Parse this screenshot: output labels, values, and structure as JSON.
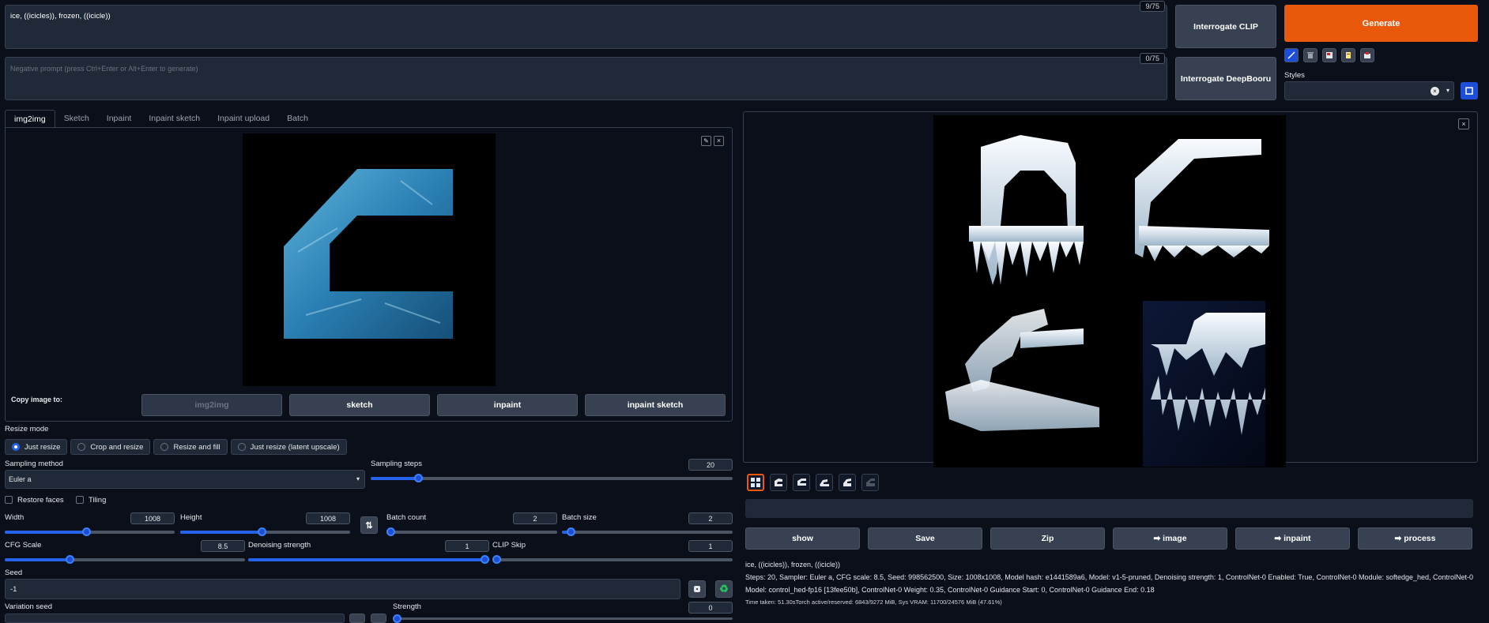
{
  "prompt": {
    "value": "ice, ((icicles)), frozen, ((icicle))",
    "token_count": "9/75"
  },
  "negative_prompt": {
    "placeholder": "Negative prompt (press Ctrl+Enter or Alt+Enter to generate)",
    "token_count": "0/75"
  },
  "interrogate": {
    "clip": "Interrogate CLIP",
    "deepbooru": "Interrogate DeepBooru"
  },
  "generate_label": "Generate",
  "styles_label": "Styles",
  "tabs": [
    "img2img",
    "Sketch",
    "Inpaint",
    "Inpaint sketch",
    "Inpaint upload",
    "Batch"
  ],
  "copy_image": {
    "label": "Copy image to:",
    "buttons": [
      "img2img",
      "sketch",
      "inpaint",
      "inpaint sketch"
    ]
  },
  "resize_mode": {
    "label": "Resize mode",
    "options": [
      "Just resize",
      "Crop and resize",
      "Resize and fill",
      "Just resize (latent upscale)"
    ],
    "selected": 0
  },
  "sampling_method": {
    "label": "Sampling method",
    "value": "Euler a"
  },
  "sampling_steps": {
    "label": "Sampling steps",
    "value": "20",
    "fraction": 0.13
  },
  "restore_faces": "Restore faces",
  "tiling": "Tiling",
  "width": {
    "label": "Width",
    "value": "1008",
    "fraction": 0.48
  },
  "height": {
    "label": "Height",
    "value": "1008",
    "fraction": 0.48
  },
  "swap_icon": "⇅",
  "batch_count": {
    "label": "Batch count",
    "value": "2",
    "fraction": 0.01
  },
  "batch_size": {
    "label": "Batch size",
    "value": "2",
    "fraction": 0.05
  },
  "cfg_scale": {
    "label": "CFG Scale",
    "value": "8.5",
    "fraction": 0.27
  },
  "denoising": {
    "label": "Denoising strength",
    "value": "1",
    "fraction": 1.0
  },
  "clip_skip": {
    "label": "CLIP Skip",
    "value": "1",
    "fraction": 0.0
  },
  "seed": {
    "label": "Seed",
    "value": "-1"
  },
  "variation_seed": {
    "label": "Variation seed"
  },
  "strength": {
    "label": "Strength",
    "value": "0"
  },
  "output_buttons": [
    "show",
    "Save",
    "Zip",
    "➡ image",
    "➡ inpaint",
    "➡ process"
  ],
  "info": {
    "prompt_line": "ice, ((icicles)), frozen, ((icicle))",
    "params": "Steps: 20, Sampler: Euler a, CFG scale: 8.5, Seed: 998562500, Size: 1008x1008, Model hash: e1441589a6, Model: v1-5-pruned, Denoising strength: 1, ControlNet-0 Enabled: True, ControlNet-0 Module: softedge_hed, ControlNet-0 Model: control_hed-fp16 [13fee50b], ControlNet-0 Weight: 0.35, ControlNet-0 Guidance Start: 0, ControlNet-0 Guidance End: 0.18",
    "time": "Time taken: 51.30sTorch active/reserved: 6843/9272 MiB, Sys VRAM: 11700/24576 MiB (47.61%)"
  },
  "colors": {
    "accent": "#ea580c",
    "bg": "#0b0f19",
    "panel": "#1f2937",
    "slider": "#2563eb"
  }
}
